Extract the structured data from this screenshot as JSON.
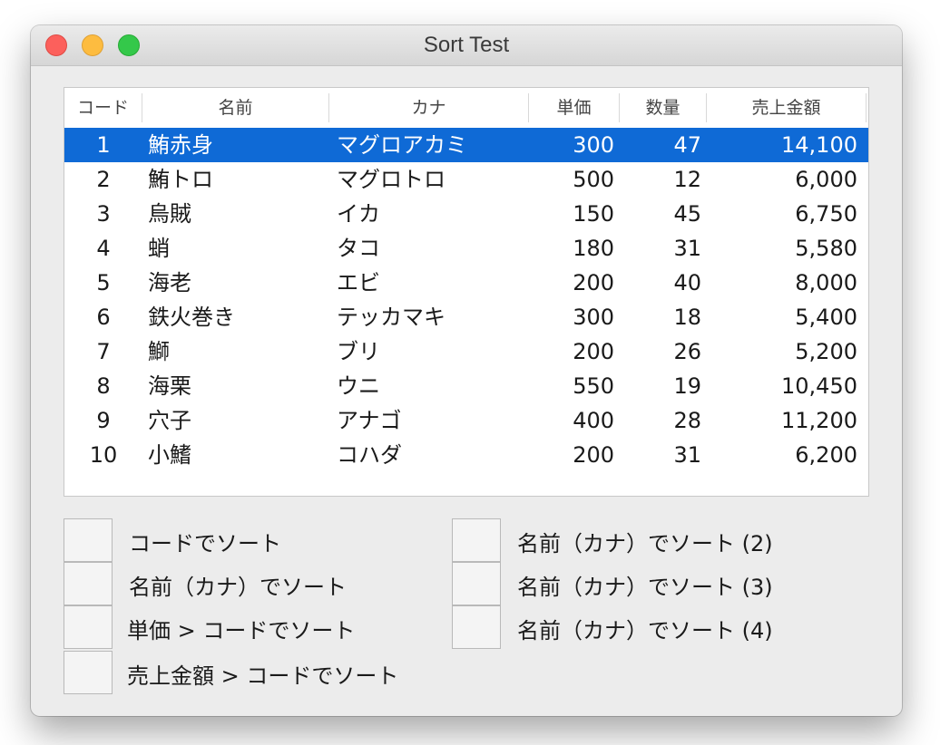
{
  "window": {
    "title": "Sort Test"
  },
  "table": {
    "headers": [
      "コード",
      "名前",
      "カナ",
      "単価",
      "数量",
      "売上金額"
    ],
    "selected_row": 0,
    "rows": [
      {
        "code": "1",
        "name": "鮪赤身",
        "kana": "マグロアカミ",
        "price": "300",
        "qty": "47",
        "sales": "14,100"
      },
      {
        "code": "2",
        "name": "鮪トロ",
        "kana": "マグロトロ",
        "price": "500",
        "qty": "12",
        "sales": "6,000"
      },
      {
        "code": "3",
        "name": "烏賊",
        "kana": "イカ",
        "price": "150",
        "qty": "45",
        "sales": "6,750"
      },
      {
        "code": "4",
        "name": "蛸",
        "kana": "タコ",
        "price": "180",
        "qty": "31",
        "sales": "5,580"
      },
      {
        "code": "5",
        "name": "海老",
        "kana": "エビ",
        "price": "200",
        "qty": "40",
        "sales": "8,000"
      },
      {
        "code": "6",
        "name": "鉄火巻き",
        "kana": "テッカマキ",
        "price": "300",
        "qty": "18",
        "sales": "5,400"
      },
      {
        "code": "7",
        "name": "鰤",
        "kana": "ブリ",
        "price": "200",
        "qty": "26",
        "sales": "5,200"
      },
      {
        "code": "8",
        "name": "海栗",
        "kana": "ウニ",
        "price": "550",
        "qty": "19",
        "sales": "10,450"
      },
      {
        "code": "9",
        "name": "穴子",
        "kana": "アナゴ",
        "price": "400",
        "qty": "28",
        "sales": "11,200"
      },
      {
        "code": "10",
        "name": "小鰭",
        "kana": "コハダ",
        "price": "200",
        "qty": "31",
        "sales": "6,200"
      }
    ]
  },
  "buttons": {
    "left": [
      "コードでソート",
      "名前（カナ）でソート",
      "単価 > コードでソート",
      "売上金額 > コードでソート"
    ],
    "right": [
      "名前（カナ）でソート (2)",
      "名前（カナ）でソート (3)",
      "名前（カナ）でソート (4)"
    ]
  },
  "colors": {
    "selection": "#0f6ad6",
    "close": "#fc605c",
    "minimize": "#fdbc40",
    "zoom": "#34c84a"
  }
}
